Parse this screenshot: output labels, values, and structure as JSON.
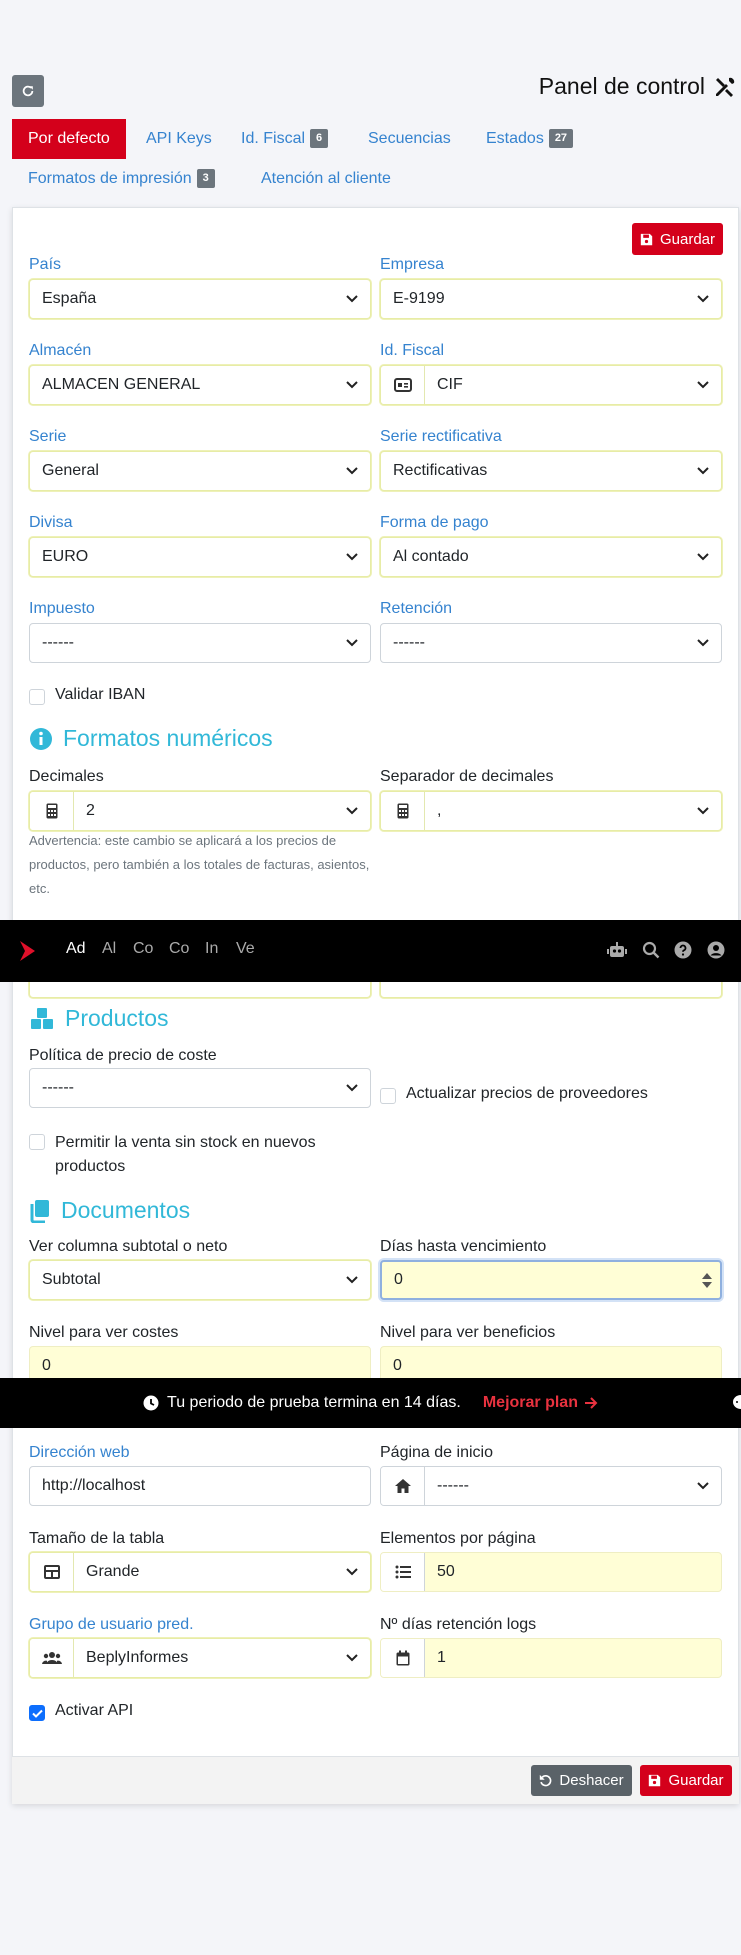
{
  "header": {
    "title": "Panel de control",
    "refresh_icon": "refresh-icon",
    "tools_icon": "tools-icon"
  },
  "tabs": [
    {
      "label": "Por defecto",
      "active": true
    },
    {
      "label": "API Keys"
    },
    {
      "label": "Id. Fiscal",
      "badge": "6"
    },
    {
      "label": "Secuencias"
    },
    {
      "label": "Estados",
      "badge": "27"
    },
    {
      "label": "Formatos de impresión",
      "badge": "3"
    },
    {
      "label": "Atención al cliente"
    }
  ],
  "actions": {
    "save": "Guardar",
    "undo": "Deshacer"
  },
  "defaults": {
    "pais": {
      "label": "País",
      "value": "España"
    },
    "empresa": {
      "label": "Empresa",
      "value": "E-9199"
    },
    "almacen": {
      "label": "Almacén",
      "value": "ALMACEN GENERAL"
    },
    "idfiscal": {
      "label": "Id. Fiscal",
      "value": "CIF"
    },
    "serie": {
      "label": "Serie",
      "value": "General"
    },
    "serie_rect": {
      "label": "Serie rectificativa",
      "value": "Rectificativas"
    },
    "divisa": {
      "label": "Divisa",
      "value": "EURO"
    },
    "forma_pago": {
      "label": "Forma de pago",
      "value": "Al contado"
    },
    "impuesto": {
      "label": "Impuesto",
      "value": "------"
    },
    "retencion": {
      "label": "Retención",
      "value": "------"
    },
    "validar_iban": {
      "label": "Validar IBAN",
      "checked": false
    }
  },
  "numeric": {
    "title": "Formatos numéricos",
    "decimales": {
      "label": "Decimales",
      "value": "2"
    },
    "separador": {
      "label": "Separador de decimales",
      "value": ","
    },
    "warning": "Advertencia: este cambio se aplicará a los precios de productos, pero también a los totales de facturas, asientos, etc."
  },
  "navbar": {
    "items": [
      "Ad",
      "Al",
      "Co",
      "Co",
      "In",
      "Ve"
    ],
    "active_index": 0
  },
  "products": {
    "title": "Productos",
    "politica": {
      "label": "Política de precio de coste",
      "value": "------"
    },
    "actualizar": {
      "label": "Actualizar precios de proveedores",
      "checked": false
    },
    "venta_sin_stock": {
      "label_line1": "Permitir la venta sin stock en nuevos",
      "label_line2": "productos",
      "checked": false
    }
  },
  "documents": {
    "title": "Documentos",
    "columna": {
      "label": "Ver columna subtotal o neto",
      "value": "Subtotal"
    },
    "dias": {
      "label": "Días hasta vencimiento",
      "value": "0"
    },
    "nivel_costes": {
      "label": "Nivel para ver costes",
      "value": "0"
    },
    "nivel_beneficios": {
      "label": "Nivel para ver beneficios",
      "value": "0"
    }
  },
  "trial": {
    "message": "Tu periodo de prueba termina en 14 días.",
    "link": "Mejorar plan"
  },
  "system": {
    "direccion": {
      "label": "Dirección web",
      "value": "http://localhost"
    },
    "pagina_inicio": {
      "label": "Página de inicio",
      "value": "------"
    },
    "tamano_tabla": {
      "label": "Tamaño de la tabla",
      "value": "Grande"
    },
    "elementos": {
      "label": "Elementos por página",
      "value": "50"
    },
    "grupo": {
      "label": "Grupo de usuario pred.",
      "value": "BeplyInformes"
    },
    "dias_logs": {
      "label": "Nº días retención logs",
      "value": "1"
    },
    "activar_api": {
      "label": "Activar API",
      "checked": true
    }
  },
  "colors": {
    "brand_red": "#d4001b",
    "link_blue": "#3583cf",
    "section_cyan": "#31b8d8"
  }
}
